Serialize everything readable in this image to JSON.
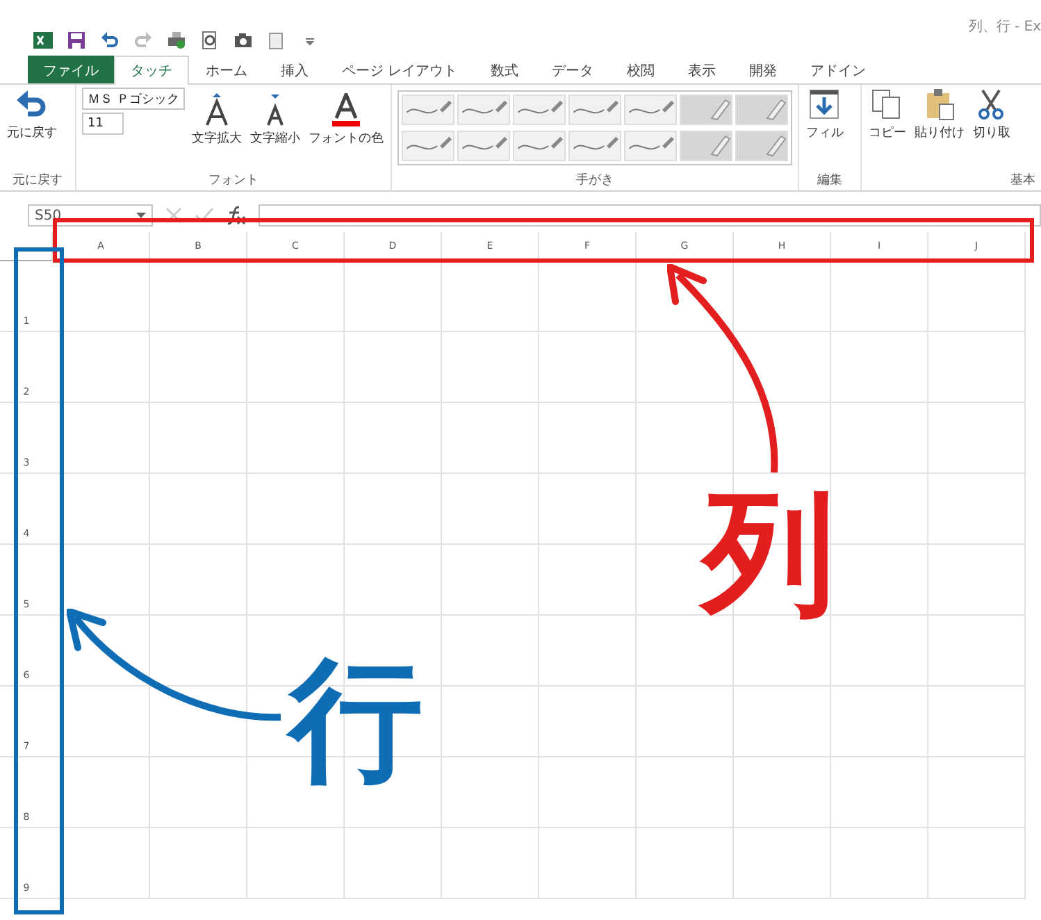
{
  "window": {
    "title": "列、行 - Ex"
  },
  "tabs": [
    {
      "label": "ファイル",
      "kind": "file",
      "selected": false
    },
    {
      "label": "タッチ",
      "kind": "tab",
      "selected": true
    },
    {
      "label": "ホーム",
      "kind": "tab",
      "selected": false
    },
    {
      "label": "挿入",
      "kind": "tab",
      "selected": false
    },
    {
      "label": "ページ レイアウト",
      "kind": "tab",
      "selected": false
    },
    {
      "label": "数式",
      "kind": "tab",
      "selected": false
    },
    {
      "label": "データ",
      "kind": "tab",
      "selected": false
    },
    {
      "label": "校閲",
      "kind": "tab",
      "selected": false
    },
    {
      "label": "表示",
      "kind": "tab",
      "selected": false
    },
    {
      "label": "開発",
      "kind": "tab",
      "selected": false
    },
    {
      "label": "アドイン",
      "kind": "tab",
      "selected": false
    }
  ],
  "ribbon": {
    "undo": {
      "label": "元に戻す",
      "group": "元に戻す"
    },
    "font": {
      "name": "ＭＳ Ｐゴシック",
      "size": "11",
      "grow": "文字拡大",
      "shrink": "文字縮小",
      "color_label": "フォントの色",
      "group": "フォント"
    },
    "pens": {
      "group": "手がき",
      "items": [
        {
          "kind": "pen"
        },
        {
          "kind": "pen"
        },
        {
          "kind": "pen"
        },
        {
          "kind": "pen"
        },
        {
          "kind": "pen"
        },
        {
          "kind": "highlighter"
        },
        {
          "kind": "highlighter"
        },
        {
          "kind": "pen"
        },
        {
          "kind": "pen"
        },
        {
          "kind": "pen"
        },
        {
          "kind": "pen"
        },
        {
          "kind": "pen"
        },
        {
          "kind": "highlighter"
        },
        {
          "kind": "highlighter"
        }
      ]
    },
    "edit": {
      "fill": "フィル",
      "group": "編集"
    },
    "basic": {
      "buttons": [
        "コピー",
        "貼り付け",
        "切り取"
      ],
      "group": "基本"
    }
  },
  "formula_bar": {
    "name_box": "S50"
  },
  "sheet": {
    "columns": [
      "A",
      "B",
      "C",
      "D",
      "E",
      "F",
      "G",
      "H",
      "I",
      "J"
    ],
    "rows": [
      "1",
      "2",
      "3",
      "4",
      "5",
      "6",
      "7",
      "8",
      "9"
    ]
  },
  "annotations": [
    {
      "kind": "column",
      "text": "列",
      "color": "#e31e1e"
    },
    {
      "kind": "row",
      "text": "行",
      "color": "#0f6db5"
    }
  ]
}
